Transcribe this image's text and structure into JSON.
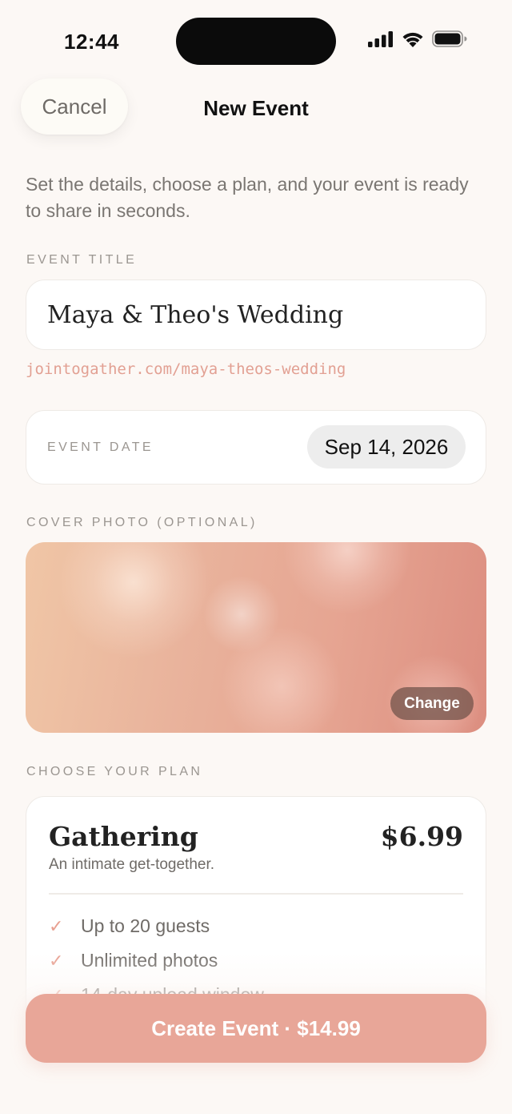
{
  "status": {
    "time": "12:44"
  },
  "nav": {
    "cancel_label": "Cancel",
    "title": "New Event"
  },
  "intro_text": "Set the details, choose a plan, and your event is ready to share in seconds.",
  "event_title": {
    "label": "EVENT TITLE",
    "value": "Maya & Theo's Wedding",
    "slug": "jointogather.com/maya-theos-wedding"
  },
  "event_date": {
    "label": "EVENT DATE",
    "value": "Sep 14, 2026"
  },
  "cover_photo": {
    "label": "COVER PHOTO (OPTIONAL)",
    "change_label": "Change"
  },
  "plan": {
    "section_label": "CHOOSE YOUR PLAN",
    "name": "Gathering",
    "price": "$6.99",
    "description": "An intimate get-together.",
    "features": [
      {
        "text": "Up to 20 guests",
        "icon": "check-icon"
      },
      {
        "text": "Unlimited photos",
        "icon": "check-icon"
      },
      {
        "text": "14-day upload window",
        "icon": "check-icon"
      }
    ]
  },
  "cta": {
    "label": "Create Event · $14.99"
  },
  "colors": {
    "accent": "#e8a698",
    "slug": "#e2a093",
    "background": "#fcf8f5"
  }
}
